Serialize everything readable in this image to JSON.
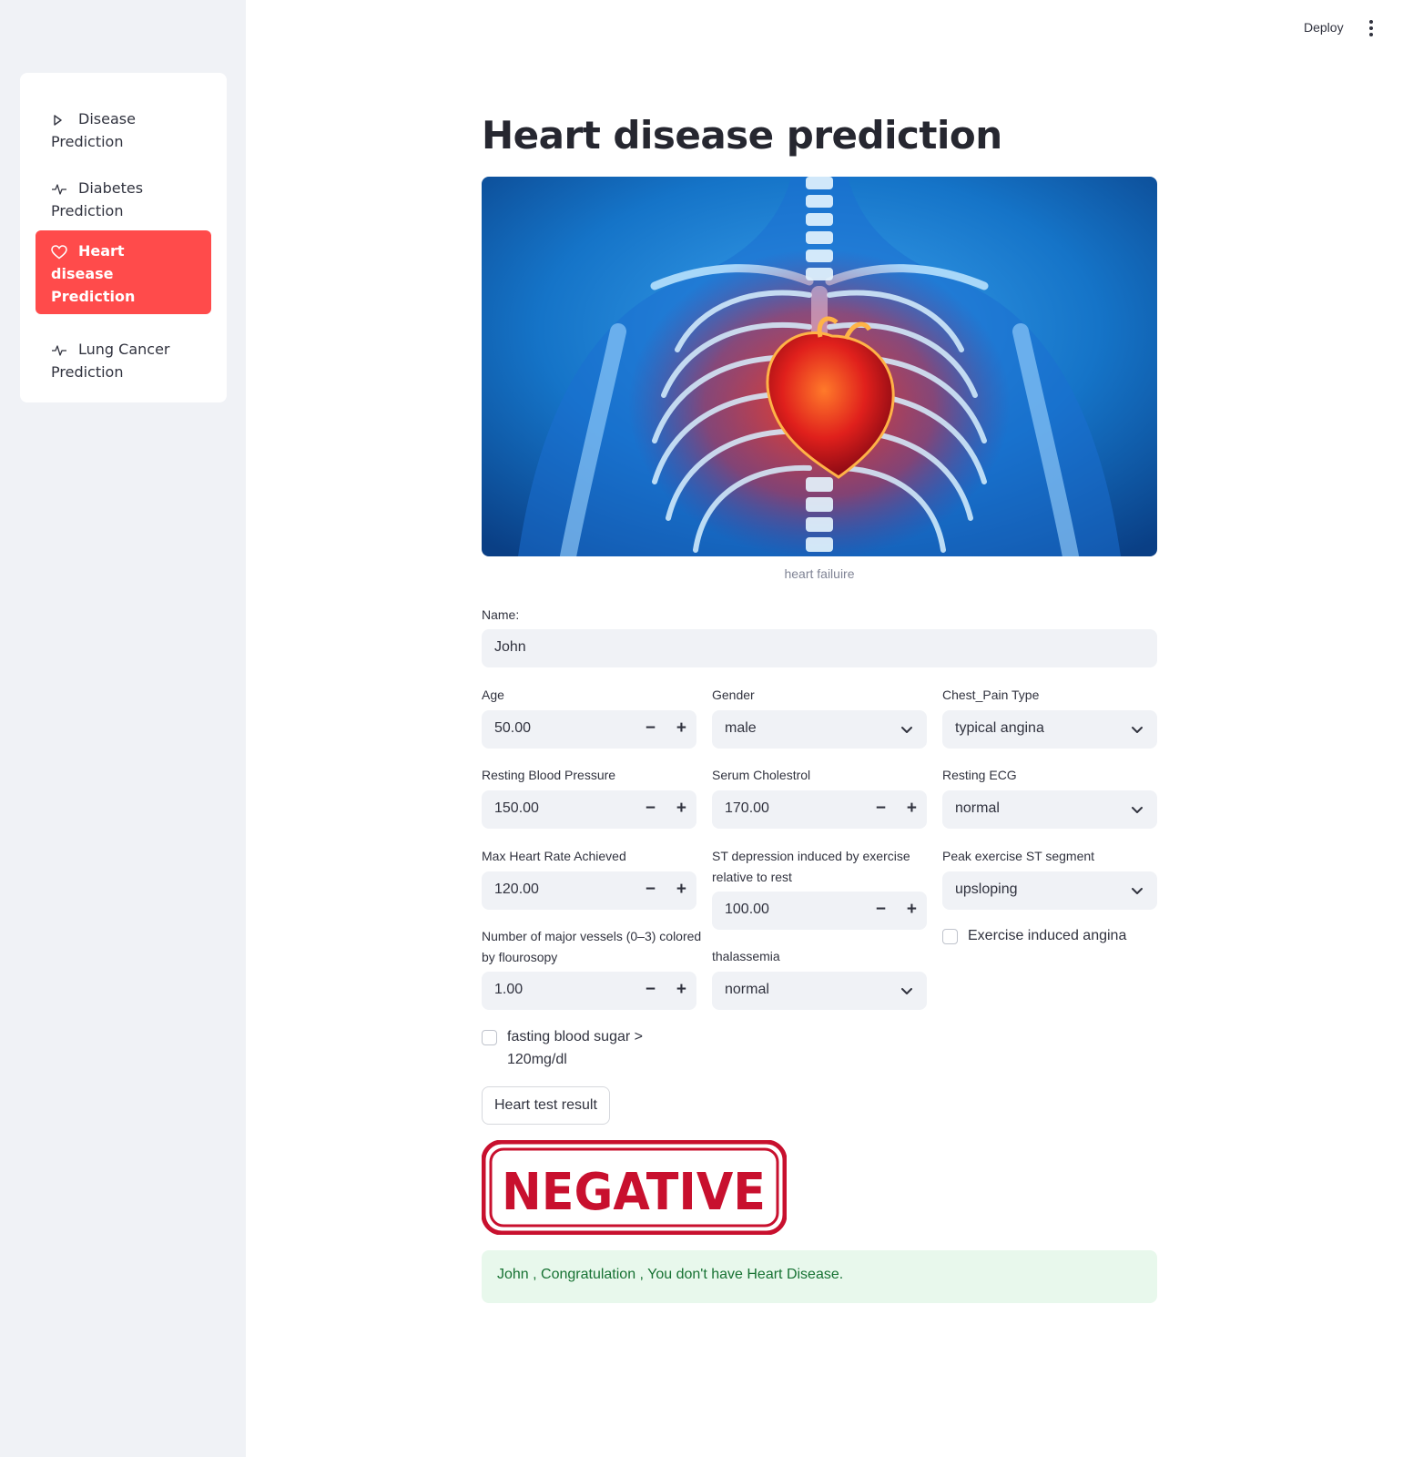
{
  "sidebar": {
    "items": [
      {
        "label_line1": "Disease",
        "label_line2": "Prediction",
        "icon": "play-outline-icon"
      },
      {
        "label_line1": "Diabetes",
        "label_line2": "Prediction",
        "icon": "pulse-icon"
      },
      {
        "label_line1": "Heart",
        "label_line2": "disease",
        "label_line3": "Prediction",
        "icon": "heart-icon",
        "active": true
      },
      {
        "label_line1": "Lung Cancer",
        "label_line2": "Prediction",
        "icon": "pulse-icon"
      }
    ],
    "active_color": "#ff4b4b"
  },
  "header": {
    "deploy_label": "Deploy",
    "menu_icon": "more-vertical-icon"
  },
  "main": {
    "title": "Heart disease prediction",
    "image_caption": "heart failuire",
    "name_label": "Name:",
    "name_value": "John",
    "fields": {
      "age": {
        "label": "Age",
        "value": "50.00"
      },
      "gender": {
        "label": "Gender",
        "value": "male"
      },
      "chest_pain": {
        "label": "Chest_Pain Type",
        "value": "typical angina"
      },
      "resting_bp": {
        "label": "Resting Blood Pressure",
        "value": "150.00"
      },
      "cholesterol": {
        "label": "Serum Cholestrol",
        "value": "170.00"
      },
      "resting_ecg": {
        "label": "Resting ECG",
        "value": "normal"
      },
      "max_hr": {
        "label": "Max Heart Rate Achieved",
        "value": "120.00"
      },
      "st_depression": {
        "label_line1": "ST depression induced by exercise",
        "label_line2": "relative to rest",
        "value": "100.00"
      },
      "peak_st": {
        "label": "Peak exercise ST segment",
        "value": "upsloping"
      },
      "vessels": {
        "label_line1": "Number of major vessels (0–3) colored",
        "label_line2": "by flourosopy",
        "value": "1.00"
      },
      "thalassemia": {
        "label": "thalassemia",
        "value": "normal"
      }
    },
    "exercise_angina": {
      "label": "Exercise induced angina",
      "checked": false
    },
    "fasting_sugar": {
      "label_line1": "fasting blood sugar >",
      "label_line2": "120mg/dl",
      "checked": false
    },
    "stepper_minus": "−",
    "stepper_plus": "+",
    "result_button": "Heart test result",
    "stamp_text": "NEGATIVE",
    "success_message": "John , Congratulation , You don't have Heart Disease.",
    "success_bg": "#e8f8ec",
    "success_color": "#177233"
  }
}
